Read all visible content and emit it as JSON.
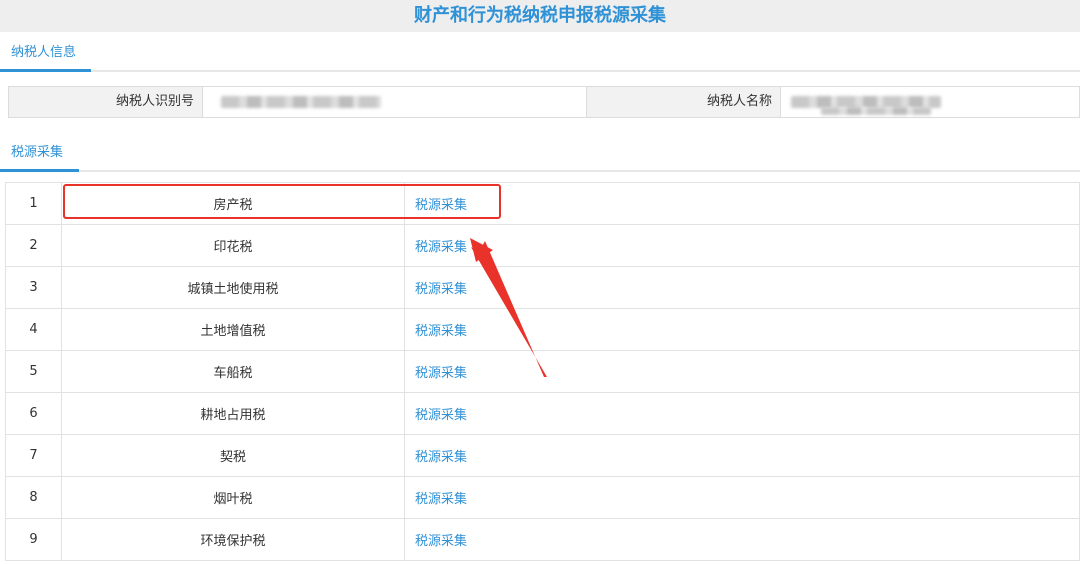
{
  "header": {
    "title": "财产和行为税纳税申报税源采集"
  },
  "sections": {
    "taxpayer_info": "纳税人信息",
    "source_collection": "税源采集"
  },
  "taxpayer": {
    "id_label": "纳税人识别号",
    "name_label": "纳税人名称"
  },
  "table": {
    "rows": [
      {
        "no": "1",
        "name": "房产税",
        "action": "税源采集"
      },
      {
        "no": "2",
        "name": "印花税",
        "action": "税源采集"
      },
      {
        "no": "3",
        "name": "城镇土地使用税",
        "action": "税源采集"
      },
      {
        "no": "4",
        "name": "土地增值税",
        "action": "税源采集"
      },
      {
        "no": "5",
        "name": "车船税",
        "action": "税源采集"
      },
      {
        "no": "6",
        "name": "耕地占用税",
        "action": "税源采集"
      },
      {
        "no": "7",
        "name": "契税",
        "action": "税源采集"
      },
      {
        "no": "8",
        "name": "烟叶税",
        "action": "税源采集"
      },
      {
        "no": "9",
        "name": "环境保护税",
        "action": "税源采集"
      }
    ]
  },
  "colors": {
    "accent": "#2f91d6",
    "annotation_red": "#e8322a"
  }
}
